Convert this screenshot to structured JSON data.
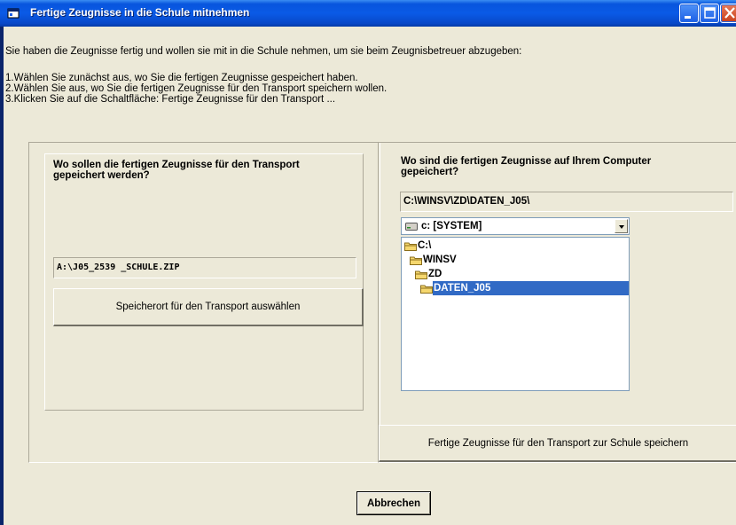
{
  "window": {
    "title": "Fertige Zeugnisse in die Schule mitnehmen"
  },
  "intro": {
    "line1": "Sie haben die Zeugnisse fertig und wollen sie mit in die Schule nehmen, um sie beim Zeugnisbetreuer abzugeben:",
    "step1": "1.Wählen Sie zunächst aus, wo Sie die fertigen Zeugnisse gespeichert haben.",
    "step2": "2.Wählen Sie aus, wo Sie die fertigen Zeugnisse für den Transport speichern wollen.",
    "step3": "3.Klicken Sie auf die Schaltfläche: Fertige Zeugnisse für den Transport ..."
  },
  "left_panel": {
    "heading_line1": "Wo sollen die fertigen Zeugnisse für den Transport",
    "heading_line2": "gepeichert werden?",
    "target_path": "A:\\J05_2539 _SCHULE.ZIP",
    "choose_button": "Speicherort für den Transport auswählen"
  },
  "right_panel": {
    "heading_line1": "Wo sind die fertigen Zeugnisse auf Ihrem Computer",
    "heading_line2": "gepeichert?",
    "source_path": "C:\\WINSV\\ZD\\DATEN_J05\\",
    "drive_selected": "c: [SYSTEM]",
    "folders": [
      {
        "label": "C:\\",
        "selected": false
      },
      {
        "label": "WINSV",
        "selected": false
      },
      {
        "label": "ZD",
        "selected": false
      },
      {
        "label": "DATEN_J05",
        "selected": true
      }
    ],
    "save_button": "Fertige Zeugnisse für den Transport zur Schule speichern"
  },
  "footer": {
    "cancel_button": "Abbrechen"
  },
  "icons": {
    "title": "app-window-icon",
    "minimize": "minimize-icon",
    "maximize": "maximize-icon",
    "close": "close-icon",
    "drive": "hard-drive-icon",
    "folder": "folder-icon"
  },
  "colors": {
    "titlebar": "#0a5ae6",
    "selection": "#316ac5",
    "window_bg": "#ece9d8"
  }
}
